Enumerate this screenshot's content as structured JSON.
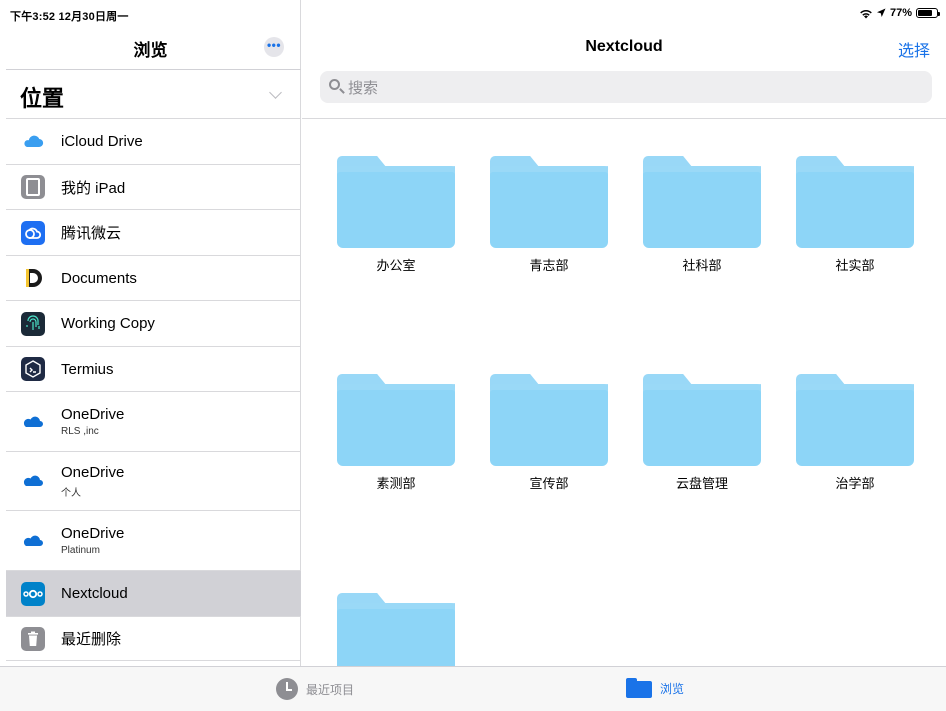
{
  "status": {
    "time": "下午3:52  12月30日周一",
    "battery": "77%",
    "battery_level": 0.77
  },
  "sidebar": {
    "title": "浏览",
    "more_label": "•••",
    "section": "位置",
    "locations": [
      {
        "label": "iCloud Drive",
        "sub": "",
        "icon": "icloud-icon"
      },
      {
        "label": "我的 iPad",
        "sub": "",
        "icon": "ipad-icon"
      },
      {
        "label": "腾讯微云",
        "sub": "",
        "icon": "weiyun-icon"
      },
      {
        "label": "Documents",
        "sub": "",
        "icon": "documents-icon"
      },
      {
        "label": "Working Copy",
        "sub": "",
        "icon": "fingerprint-icon"
      },
      {
        "label": "Termius",
        "sub": "",
        "icon": "termius-icon"
      },
      {
        "label": "OneDrive",
        "sub": "RLS ,inc",
        "icon": "onedrive-icon"
      },
      {
        "label": "OneDrive",
        "sub": "个人",
        "icon": "onedrive-icon"
      },
      {
        "label": "OneDrive",
        "sub": "Platinum",
        "icon": "onedrive-icon"
      },
      {
        "label": "Nextcloud",
        "sub": "",
        "icon": "nextcloud-icon",
        "selected": true
      },
      {
        "label": "最近删除",
        "sub": "",
        "icon": "trash-icon"
      }
    ]
  },
  "main": {
    "title": "Nextcloud",
    "select_label": "选择",
    "search_placeholder": "搜索",
    "folders": [
      "办公室",
      "青志部",
      "社科部",
      "社实部",
      "素测部",
      "宣传部",
      "云盘管理",
      "治学部",
      ""
    ]
  },
  "tabbar": {
    "recents": "最近项目",
    "browse": "浏览"
  },
  "colors": {
    "accent": "#1a73e8",
    "folder": "#8dd5f7",
    "selected_row": "#d1d1d6"
  }
}
